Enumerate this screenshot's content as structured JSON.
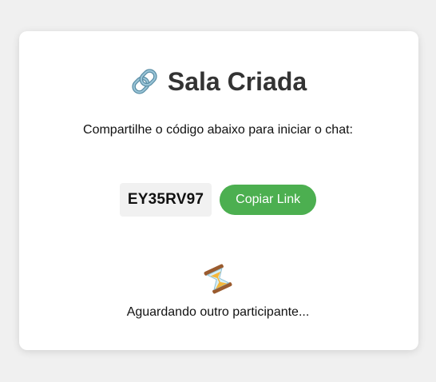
{
  "room": {
    "title": "Sala Criada",
    "title_icon": "link-icon",
    "instruction": "Compartilhe o código abaixo para iniciar o chat:",
    "code": "EY35RV97",
    "copy_button_label": "Copiar Link",
    "waiting_icon": "hourglass-icon",
    "waiting_text": "Aguardando outro participante..."
  },
  "colors": {
    "background": "#f0f0f0",
    "card": "#ffffff",
    "accent": "#4caf50",
    "code_background": "#f1f1f1",
    "title_text": "#333333"
  }
}
